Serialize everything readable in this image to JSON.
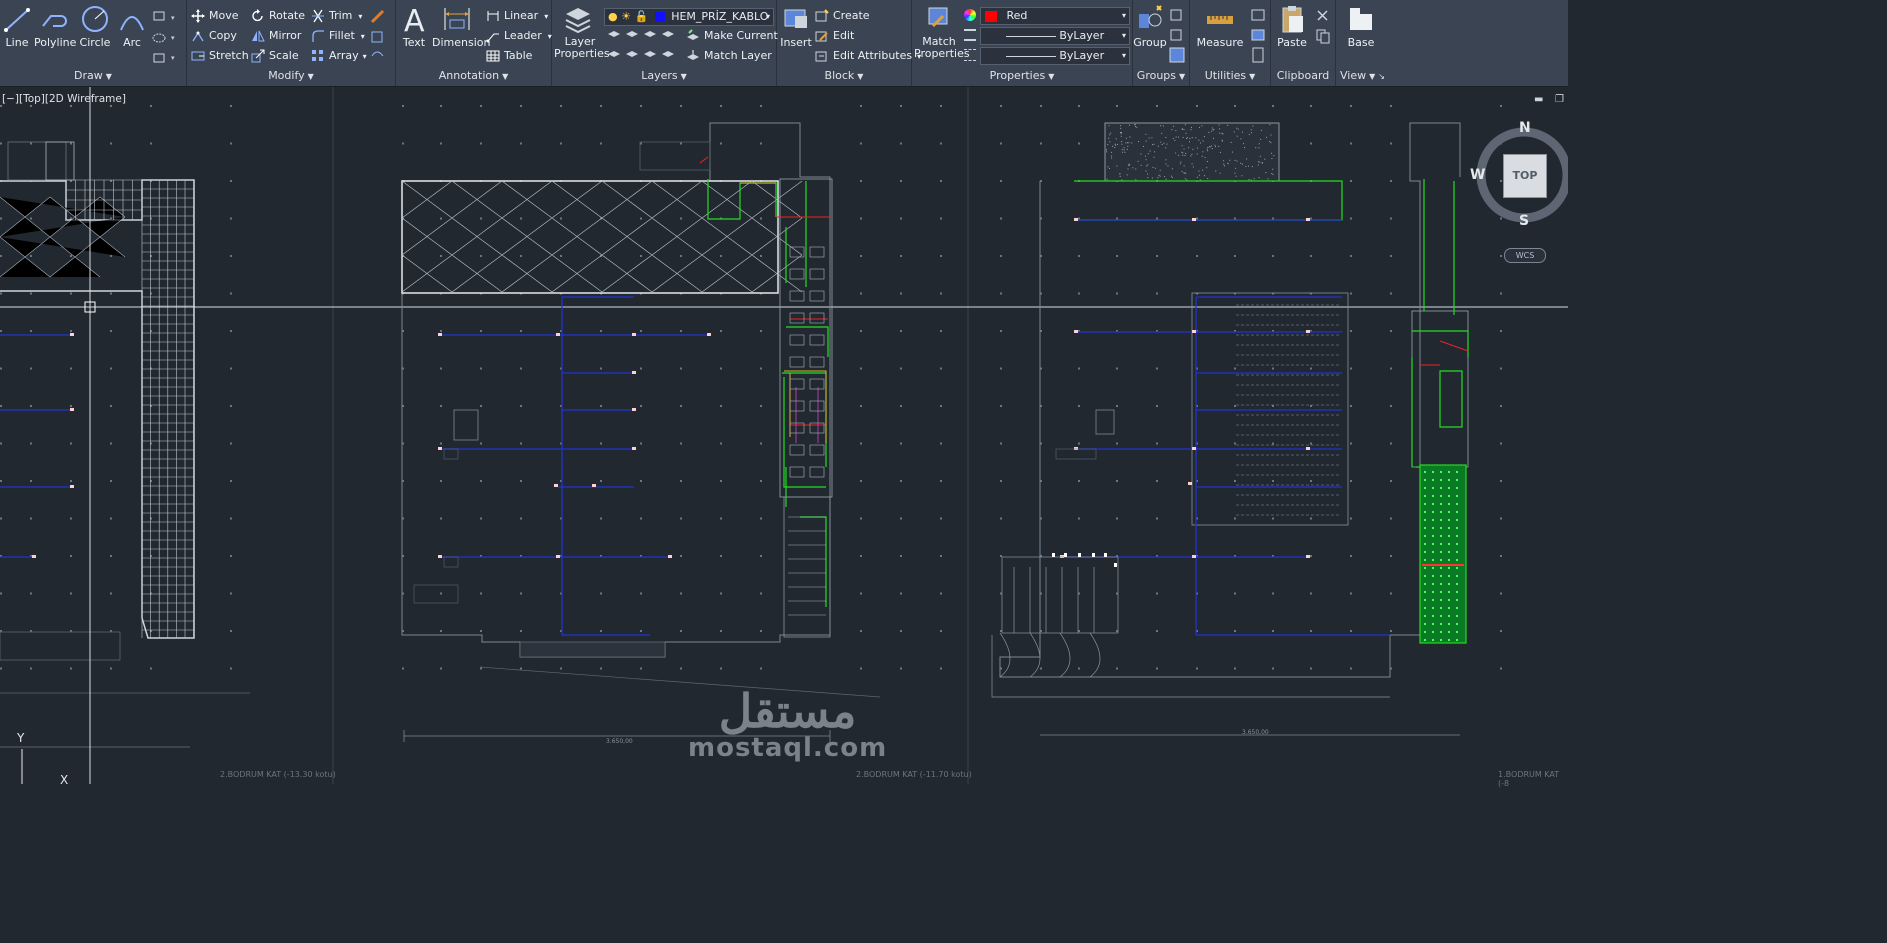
{
  "ribbon": {
    "draw": {
      "label": "Draw",
      "line": "Line",
      "polyline": "Polyline",
      "circle": "Circle",
      "arc": "Arc"
    },
    "modify": {
      "label": "Modify",
      "move": "Move",
      "rotate": "Rotate",
      "trim": "Trim",
      "copy": "Copy",
      "mirror": "Mirror",
      "fillet": "Fillet",
      "stretch": "Stretch",
      "scale": "Scale",
      "array": "Array"
    },
    "annotation": {
      "label": "Annotation",
      "text": "Text",
      "dimension": "Dimension",
      "linear": "Linear",
      "leader": "Leader",
      "table": "Table"
    },
    "layers": {
      "label": "Layers",
      "layer_properties": "Layer Properties",
      "current_layer": "HEM_PRİZ_KABLO",
      "make_current": "Make Current",
      "match_layer": "Match Layer"
    },
    "block": {
      "label": "Block",
      "insert": "Insert",
      "create": "Create",
      "edit": "Edit",
      "edit_attributes": "Edit Attributes"
    },
    "properties": {
      "label": "Properties",
      "match_properties": "Match Properties",
      "color": "Red",
      "linetype": "ByLayer",
      "lineweight": "ByLayer"
    },
    "groups": {
      "label": "Groups",
      "group": "Group"
    },
    "utilities": {
      "label": "Utilities",
      "measure": "Measure"
    },
    "clipboard": {
      "label": "Clipboard",
      "paste": "Paste"
    },
    "view": {
      "label": "View",
      "base": "Base"
    }
  },
  "viewport": {
    "label": "[−][Top][2D Wireframe]",
    "viewcube": {
      "top": "TOP",
      "north": "N",
      "south": "S",
      "west": "W"
    },
    "wcs": "WCS",
    "ucs_y": "Y",
    "ucs_x": "X"
  },
  "sheets": {
    "left": "2.BODRUM KAT (-13.30 kotu)",
    "middle": "2.BODRUM KAT (-11.70 kotu)",
    "right": "1.BODRUM KAT (-8"
  },
  "dim_texts": {
    "mid": "3.650,00",
    "right": "3.650,00"
  },
  "watermark": {
    "arabic": "مستقل",
    "latin": "mostaql.com"
  },
  "colors": {
    "accent_red": "#ff0000",
    "layer_blue": "#1010ff",
    "wire_blue": "#2233cc",
    "wire_green": "#22dd22",
    "bg": "#212830"
  }
}
